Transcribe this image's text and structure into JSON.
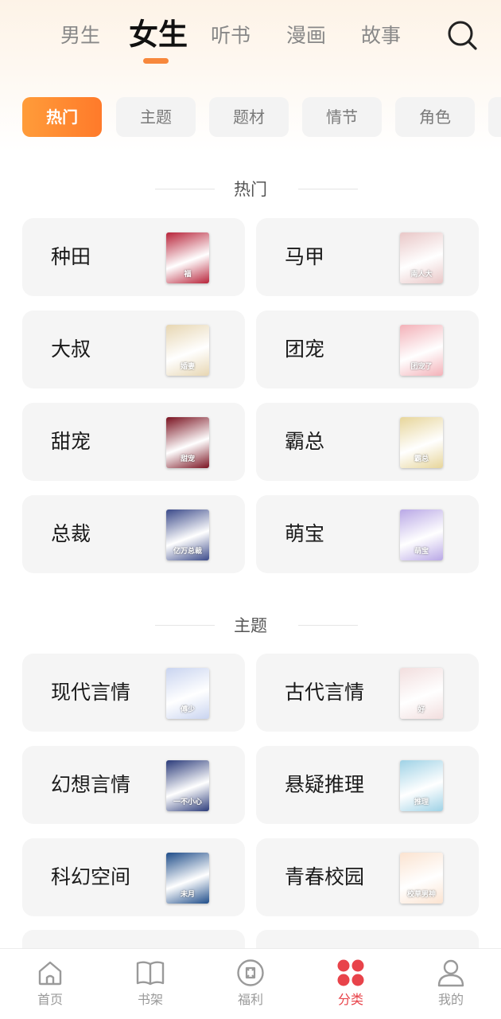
{
  "top_tabs": [
    {
      "label": "男生"
    },
    {
      "label": "女生",
      "active": true
    },
    {
      "label": "听书"
    },
    {
      "label": "漫画"
    },
    {
      "label": "故事"
    }
  ],
  "search": {
    "icon": "search-icon"
  },
  "chips": [
    {
      "label": "热门",
      "active": true
    },
    {
      "label": "主题"
    },
    {
      "label": "题材"
    },
    {
      "label": "情节"
    },
    {
      "label": "角色"
    }
  ],
  "sections": [
    {
      "title": "热门",
      "items": [
        {
          "label": "种田",
          "cover_color": "#b8243a",
          "cover_title": "福"
        },
        {
          "label": "马甲",
          "cover_color": "#e9c7c7",
          "cover_title": "南人大"
        },
        {
          "label": "大叔",
          "cover_color": "#e7d6b2",
          "cover_title": "婚妻"
        },
        {
          "label": "团宠",
          "cover_color": "#f3b1b8",
          "cover_title": "团宠了"
        },
        {
          "label": "甜宠",
          "cover_color": "#7a1220",
          "cover_title": "甜宠"
        },
        {
          "label": "霸总",
          "cover_color": "#e7d59a",
          "cover_title": "霸总"
        },
        {
          "label": "总裁",
          "cover_color": "#3b4a8a",
          "cover_title": "亿万总裁"
        },
        {
          "label": "萌宝",
          "cover_color": "#b9a8e6",
          "cover_title": "萌宝"
        }
      ]
    },
    {
      "title": "主题",
      "items": [
        {
          "label": "现代言情",
          "cover_color": "#c9d4f0",
          "cover_title": "傅少"
        },
        {
          "label": "古代言情",
          "cover_color": "#f2dede",
          "cover_title": "好"
        },
        {
          "label": "幻想言情",
          "cover_color": "#2b3b7a",
          "cover_title": "一不小心"
        },
        {
          "label": "悬疑推理",
          "cover_color": "#9fd2e6",
          "cover_title": "推理"
        },
        {
          "label": "科幻空间",
          "cover_color": "#1f4d8a",
          "cover_title": "未月"
        },
        {
          "label": "青春校园",
          "cover_color": "#fbe3d0",
          "cover_title": "校草男神"
        }
      ]
    }
  ],
  "bottom_nav": [
    {
      "label": "首页",
      "icon": "home-icon"
    },
    {
      "label": "书架",
      "icon": "book-icon"
    },
    {
      "label": "福利",
      "icon": "gift-icon"
    },
    {
      "label": "分类",
      "icon": "category-icon",
      "active": true
    },
    {
      "label": "我的",
      "icon": "user-icon"
    }
  ],
  "colors": {
    "accent": "#f7883c",
    "active_nav": "#e8434a",
    "card_bg": "#f5f5f5"
  }
}
